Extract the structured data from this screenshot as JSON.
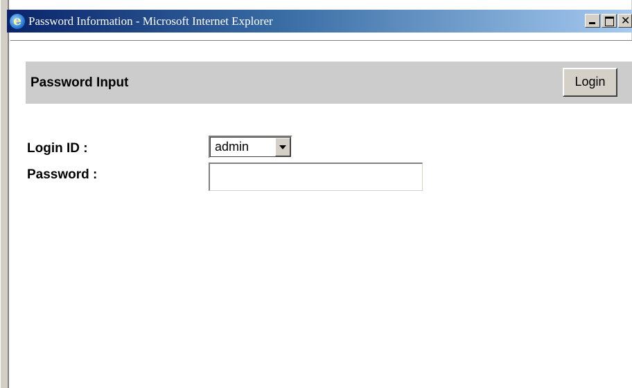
{
  "window": {
    "title": "Password Information - Microsoft Internet Explorer",
    "icon": "internet-explorer-icon",
    "controls": [
      "minimize-icon",
      "maximize-icon",
      "close-icon"
    ]
  },
  "header": {
    "title": "Password Input",
    "login_button": "Login"
  },
  "form": {
    "login_id_label": "Login ID :",
    "login_id_value": "admin",
    "password_label": "Password :",
    "password_value": ""
  },
  "colors": {
    "titlebar_start": "#0a246a",
    "titlebar_end": "#a6caf0",
    "header_bar": "#cccccc",
    "button_face": "#d4d0c8"
  }
}
